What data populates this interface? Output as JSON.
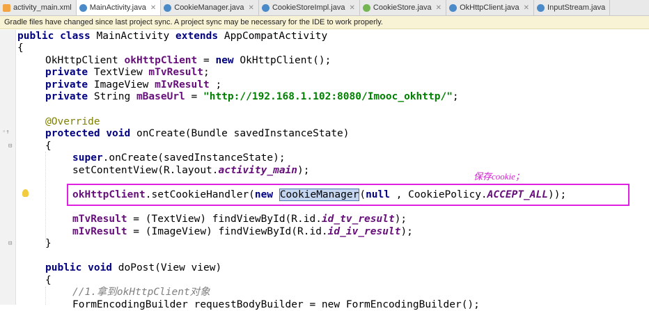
{
  "tabs": [
    {
      "label": "activity_main.xml",
      "icon": "xml-file-icon",
      "active": false
    },
    {
      "label": "MainActivity.java",
      "icon": "class-icon",
      "active": true
    },
    {
      "label": "CookieManager.java",
      "icon": "class-icon",
      "active": false
    },
    {
      "label": "CookieStoreImpl.java",
      "icon": "class-icon",
      "active": false
    },
    {
      "label": "CookieStore.java",
      "icon": "interface-icon",
      "active": false
    },
    {
      "label": "OkHttpClient.java",
      "icon": "class-icon",
      "active": false
    },
    {
      "label": "InputStream.java",
      "icon": "class-icon",
      "active": false
    }
  ],
  "notification": "Gradle files have changed since last project sync. A project sync may be necessary for the IDE to work properly.",
  "annotation_note": "保存cookie；",
  "code": {
    "l1_kw1": "public class ",
    "l1_name": "MainActivity ",
    "l1_kw2": "extends ",
    "l1_super": "AppCompatActivity",
    "l2": "{",
    "l3_type": "OkHttpClient ",
    "l3_field": "okHttpClient",
    "l3_eq": " = ",
    "l3_new": "new ",
    "l3_call": "OkHttpClient();",
    "l4_kw": "private ",
    "l4_type": "TextView ",
    "l4_field": "mTvResult",
    "l4_end": ";",
    "l5_kw": "private ",
    "l5_type": "ImageView ",
    "l5_field": "mIvResult",
    "l5_end": " ;",
    "l6_kw": "private ",
    "l6_type": "String ",
    "l6_field": "mBaseUrl",
    "l6_eq": " = ",
    "l6_str": "\"http://192.168.1.102:8080/Imooc_okhttp/\"",
    "l6_end": ";",
    "l7": "@Override",
    "l8_kw1": "protected ",
    "l8_kw2": "void ",
    "l8_rest": "onCreate(Bundle savedInstanceState)",
    "l9": "{",
    "l10_kw": "super",
    "l10_rest": ".onCreate(savedInstanceState);",
    "l11_a": "setContentView(R.layout.",
    "l11_b": "activity_main",
    "l11_c": ");",
    "l12_field": "okHttpClient",
    "l12_a": ".setCookieHandler(",
    "l12_new": "new ",
    "l12_sel": "CookieManager",
    "l12_b": "(",
    "l12_null": "null ",
    "l12_c": ", CookiePolicy.",
    "l12_d": "ACCEPT_ALL",
    "l12_e": "));",
    "l13_field": "mTvResult",
    "l13_a": " = (TextView) findViewById(R.id.",
    "l13_b": "id_tv_result",
    "l13_c": ");",
    "l14_field": "mIvResult",
    "l14_a": " = (ImageView) findViewById(R.id.",
    "l14_b": "id_iv_result",
    "l14_c": ");",
    "l15": "}",
    "l16_kw1": "public ",
    "l16_kw2": "void ",
    "l16_rest": "doPost(View view)",
    "l17": "{",
    "l18": "//1.拿到okHttpClient对象",
    "l19": "FormEncodingBuilder requestBodyBuilder = new FormEncodingBuilder();"
  }
}
